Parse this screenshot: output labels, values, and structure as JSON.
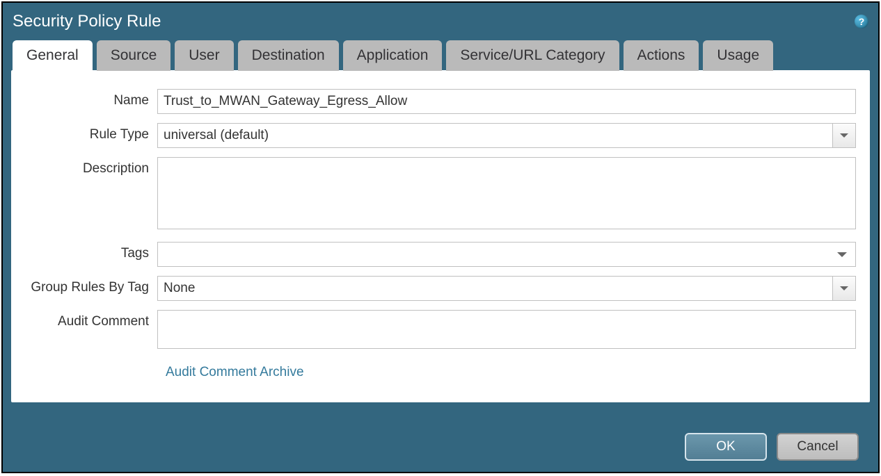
{
  "dialog": {
    "title": "Security Policy Rule"
  },
  "tabs": [
    {
      "label": "General",
      "active": true
    },
    {
      "label": "Source",
      "active": false
    },
    {
      "label": "User",
      "active": false
    },
    {
      "label": "Destination",
      "active": false
    },
    {
      "label": "Application",
      "active": false
    },
    {
      "label": "Service/URL Category",
      "active": false
    },
    {
      "label": "Actions",
      "active": false
    },
    {
      "label": "Usage",
      "active": false
    }
  ],
  "form": {
    "name": {
      "label": "Name",
      "value": "Trust_to_MWAN_Gateway_Egress_Allow"
    },
    "ruleType": {
      "label": "Rule Type",
      "value": "universal (default)"
    },
    "description": {
      "label": "Description",
      "value": ""
    },
    "tags": {
      "label": "Tags",
      "value": ""
    },
    "groupRulesByTag": {
      "label": "Group Rules By Tag",
      "value": "None"
    },
    "auditComment": {
      "label": "Audit Comment",
      "value": ""
    },
    "archiveLink": "Audit Comment Archive"
  },
  "buttons": {
    "ok": "OK",
    "cancel": "Cancel"
  }
}
